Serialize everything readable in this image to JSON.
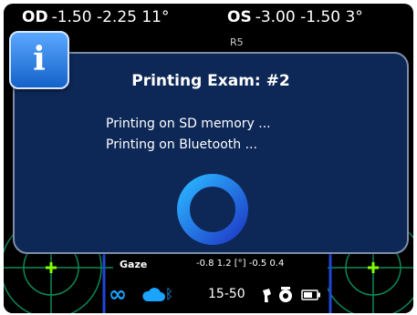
{
  "header": {
    "od": {
      "label": "OD",
      "values": "-1.50 -2.25 11°"
    },
    "os": {
      "label": "OS",
      "values": "-3.00 -1.50 3°"
    },
    "sub": "R5"
  },
  "dialog": {
    "title": "Printing Exam: #2",
    "messages": [
      "Printing on SD memory ...",
      "Printing on Bluetooth ..."
    ],
    "icon": "info-icon"
  },
  "gaze": {
    "label": "Gaze",
    "values": "-0.8  1.2 [°] -0.5  0.4"
  },
  "status": {
    "infinity": "∞",
    "time": "15-50",
    "bluetooth": "ᛒ"
  },
  "colors": {
    "dialog_bg": "#0d2857",
    "accent": "#1aa3ff",
    "grid": "#0d8a55",
    "grid_frame": "#2046d8"
  }
}
